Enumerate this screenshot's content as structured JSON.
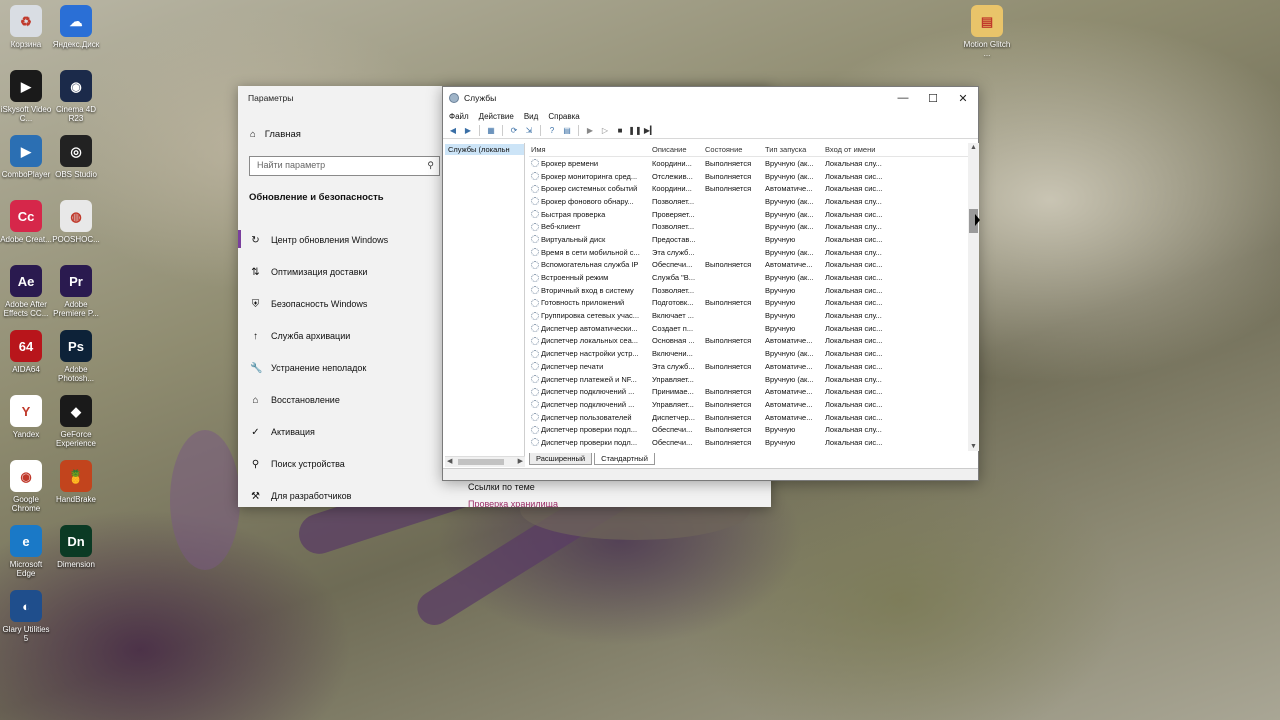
{
  "desktop": {
    "icons": [
      {
        "label": "Корзина",
        "color": "#d9dde3",
        "glyph": "♻"
      },
      {
        "label": "Яндекс.Диск",
        "color": "#2a6fd6",
        "glyph": "☁"
      },
      {
        "label": "iSkysoft Video C...",
        "color": "#1a1a1a",
        "glyph": "▶"
      },
      {
        "label": "Cinema 4D R23",
        "color": "#1b2a4a",
        "glyph": "◉"
      },
      {
        "label": "ComboPlayer",
        "color": "#2b6fb3",
        "glyph": "▶"
      },
      {
        "label": "OBS Studio",
        "color": "#222",
        "glyph": "◎"
      },
      {
        "label": "Adobe Creat...",
        "color": "#d6274a",
        "glyph": "Cc"
      },
      {
        "label": "POOSHOC...",
        "color": "#e8e8e8",
        "glyph": "◍"
      },
      {
        "label": "Adobe After Effects CC...",
        "color": "#2a1a4f",
        "glyph": "Ae"
      },
      {
        "label": "Adobe Premiere P...",
        "color": "#2a1a4f",
        "glyph": "Pr"
      },
      {
        "label": "AIDA64",
        "color": "#b8151b",
        "glyph": "64"
      },
      {
        "label": "Adobe Photosh...",
        "color": "#0d2238",
        "glyph": "Ps"
      },
      {
        "label": "Yandex",
        "color": "#ffffff",
        "glyph": "Y"
      },
      {
        "label": "GeForce Experience",
        "color": "#1a1a1a",
        "glyph": "◆"
      },
      {
        "label": "Google Chrome",
        "color": "#ffffff",
        "glyph": "◉"
      },
      {
        "label": "HandBrake",
        "color": "#c2441d",
        "glyph": "🍍"
      },
      {
        "label": "Microsoft Edge",
        "color": "#1a79c7",
        "glyph": "e"
      },
      {
        "label": "Dimension",
        "color": "#0b3a24",
        "glyph": "Dn"
      },
      {
        "label": "Glary Utilities 5",
        "color": "#1f4e8c",
        "glyph": "◐"
      },
      {
        "label": "Motion Glitch ...",
        "color": "#e9c46a",
        "glyph": "▤"
      }
    ]
  },
  "settings": {
    "title": "Параметры",
    "home": "Главная",
    "search_placeholder": "Найти параметр",
    "section": "Обновление и безопасность",
    "nav": [
      {
        "icon": "↻",
        "label": "Центр обновления Windows"
      },
      {
        "icon": "⇅",
        "label": "Оптимизация доставки"
      },
      {
        "icon": "⛨",
        "label": "Безопасность Windows"
      },
      {
        "icon": "↑",
        "label": "Служба архивации"
      },
      {
        "icon": "🔧",
        "label": "Устранение неполадок"
      },
      {
        "icon": "⌂",
        "label": "Восстановление"
      },
      {
        "icon": "✓",
        "label": "Активация"
      },
      {
        "icon": "⚲",
        "label": "Поиск устройства"
      },
      {
        "icon": "⚒",
        "label": "Для разработчиков"
      }
    ],
    "related_links": "Ссылки по теме",
    "related_link2": "Проверка хранилища"
  },
  "services": {
    "title": "Службы",
    "menu": [
      "Файл",
      "Действие",
      "Вид",
      "Справка"
    ],
    "tree_node": "Службы (локальн",
    "columns": [
      "Имя",
      "Описание",
      "Состояние",
      "Тип запуска",
      "Вход от имени"
    ],
    "rows": [
      [
        "Брокер времени",
        "Координи...",
        "Выполняется",
        "Вручную (ак...",
        "Локальная слу..."
      ],
      [
        "Брокер мониторинга сред...",
        "Отслежив...",
        "Выполняется",
        "Вручную (ак...",
        "Локальная сис..."
      ],
      [
        "Брокер системных событий",
        "Координи...",
        "Выполняется",
        "Автоматиче...",
        "Локальная сис..."
      ],
      [
        "Брокер фонового обнару...",
        "Позволяет...",
        "",
        "Вручную (ак...",
        "Локальная слу..."
      ],
      [
        "Быстрая проверка",
        "Проверяет...",
        "",
        "Вручную (ак...",
        "Локальная сис..."
      ],
      [
        "Веб-клиент",
        "Позволяет...",
        "",
        "Вручную (ак...",
        "Локальная слу..."
      ],
      [
        "Виртуальный диск",
        "Предостав...",
        "",
        "Вручную",
        "Локальная сис..."
      ],
      [
        "Время в сети мобильной с...",
        "Эта служб...",
        "",
        "Вручную (ак...",
        "Локальная слу..."
      ],
      [
        "Вспомогательная служба IP",
        "Обеспечи...",
        "Выполняется",
        "Автоматиче...",
        "Локальная сис..."
      ],
      [
        "Встроенный режим",
        "Служба \"В...",
        "",
        "Вручную (ак...",
        "Локальная сис..."
      ],
      [
        "Вторичный вход в систему",
        "Позволяет...",
        "",
        "Вручную",
        "Локальная сис..."
      ],
      [
        "Готовность приложений",
        "Подготовк...",
        "Выполняется",
        "Вручную",
        "Локальная сис..."
      ],
      [
        "Группировка сетевых учас...",
        "Включает ...",
        "",
        "Вручную",
        "Локальная слу..."
      ],
      [
        "Диспетчер автоматически...",
        "Создает п...",
        "",
        "Вручную",
        "Локальная сис..."
      ],
      [
        "Диспетчер локальных сеа...",
        "Основная ...",
        "Выполняется",
        "Автоматиче...",
        "Локальная сис..."
      ],
      [
        "Диспетчер настройки устр...",
        "Включени...",
        "",
        "Вручную (ак...",
        "Локальная сис..."
      ],
      [
        "Диспетчер печати",
        "Эта служб...",
        "Выполняется",
        "Автоматиче...",
        "Локальная сис..."
      ],
      [
        "Диспетчер платежей и NF...",
        "Управляет...",
        "",
        "Вручную (ак...",
        "Локальная слу..."
      ],
      [
        "Диспетчер подключений ...",
        "Принимае...",
        "Выполняется",
        "Автоматиче...",
        "Локальная сис..."
      ],
      [
        "Диспетчер подключений ...",
        "Управляет...",
        "Выполняется",
        "Автоматиче...",
        "Локальная сис..."
      ],
      [
        "Диспетчер пользователей",
        "Диспетчер...",
        "Выполняется",
        "Автоматиче...",
        "Локальная сис..."
      ],
      [
        "Диспетчер проверки подл...",
        "Обеспечи...",
        "Выполняется",
        "Вручную",
        "Локальная слу..."
      ],
      [
        "Диспетчер проверки подл...",
        "Обеспечи...",
        "Выполняется",
        "Вручную",
        "Локальная сис..."
      ]
    ],
    "tab_extended": "Расширенный",
    "tab_standard": "Стандартный"
  }
}
